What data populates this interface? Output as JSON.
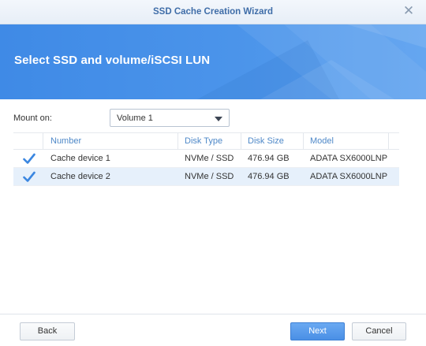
{
  "window": {
    "title": "SSD Cache Creation Wizard",
    "close_glyph": "✕"
  },
  "banner": {
    "heading": "Select SSD and volume/iSCSI LUN"
  },
  "form": {
    "mount_label": "Mount on:",
    "mount_value": "Volume 1"
  },
  "table": {
    "columns": [
      "Number",
      "Disk Type",
      "Disk Size",
      "Model"
    ],
    "rows": [
      {
        "checked": true,
        "number": "Cache device 1",
        "disk_type": "NVMe / SSD",
        "disk_size": "476.94 GB",
        "model": "ADATA SX6000LNP",
        "selected": false
      },
      {
        "checked": true,
        "number": "Cache device 2",
        "disk_type": "NVMe / SSD",
        "disk_size": "476.94 GB",
        "model": "ADATA SX6000LNP",
        "selected": true
      }
    ]
  },
  "buttons": {
    "back": "Back",
    "next": "Next",
    "cancel": "Cancel"
  },
  "colors": {
    "accent": "#4a8fe5",
    "banner": "#3f8ae6",
    "title_text": "#3f6da8",
    "header_text": "#4e88c8",
    "selected_row": "#e6f0fb"
  },
  "icons": {
    "close": "close-icon",
    "checkbox": "checkmark-icon",
    "dropdown": "chevron-down-icon"
  }
}
